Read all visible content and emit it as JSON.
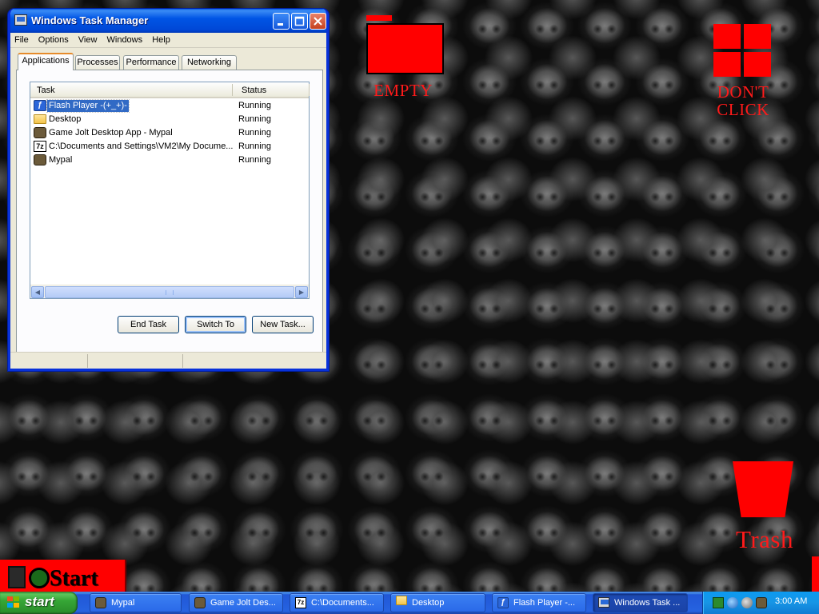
{
  "desktop": {
    "icons": {
      "empty_label": "EMPTY",
      "dont_click_line1": "DON'T",
      "dont_click_line2": "CLICK",
      "trash_label": "Trash"
    },
    "game_start_label": "Start"
  },
  "task_manager": {
    "title": "Windows Task Manager",
    "menu": [
      "File",
      "Options",
      "View",
      "Windows",
      "Help"
    ],
    "tabs": [
      "Applications",
      "Processes",
      "Performance",
      "Networking"
    ],
    "active_tab": "Applications",
    "columns": {
      "task": "Task",
      "status": "Status"
    },
    "rows": [
      {
        "task": "Flash Player  -(+_+)-",
        "status": "Running",
        "icon": "flash-player-icon",
        "selected": true
      },
      {
        "task": "Desktop",
        "status": "Running",
        "icon": "folder-icon"
      },
      {
        "task": "Game Jolt Desktop App - Mypal",
        "status": "Running",
        "icon": "mypal-icon"
      },
      {
        "task": "C:\\Documents and Settings\\VM2\\My Docume...",
        "status": "Running",
        "icon": "7zip-icon"
      },
      {
        "task": "Mypal",
        "status": "Running",
        "icon": "mypal-icon"
      }
    ],
    "buttons": {
      "end_task": "End Task",
      "switch_to": "Switch To",
      "new_task": "New Task..."
    }
  },
  "taskbar": {
    "start_label": "start",
    "tasks": [
      {
        "label": "Mypal",
        "icon": "mypal-icon"
      },
      {
        "label": "Game Jolt Des...",
        "icon": "mypal-icon"
      },
      {
        "label": "C:\\Documents...",
        "icon": "7zip-icon"
      },
      {
        "label": "Desktop",
        "icon": "folder-icon"
      },
      {
        "label": "Flash Player  -...",
        "icon": "flash-player-icon"
      },
      {
        "label": "Windows Task ...",
        "icon": "task-manager-icon",
        "active": true
      }
    ],
    "clock": "3:00 AM"
  },
  "colors": {
    "accent_red": "#ff0000",
    "xp_blue": "#0055e5",
    "start_green": "#36a636",
    "selection": "#316ac5"
  }
}
